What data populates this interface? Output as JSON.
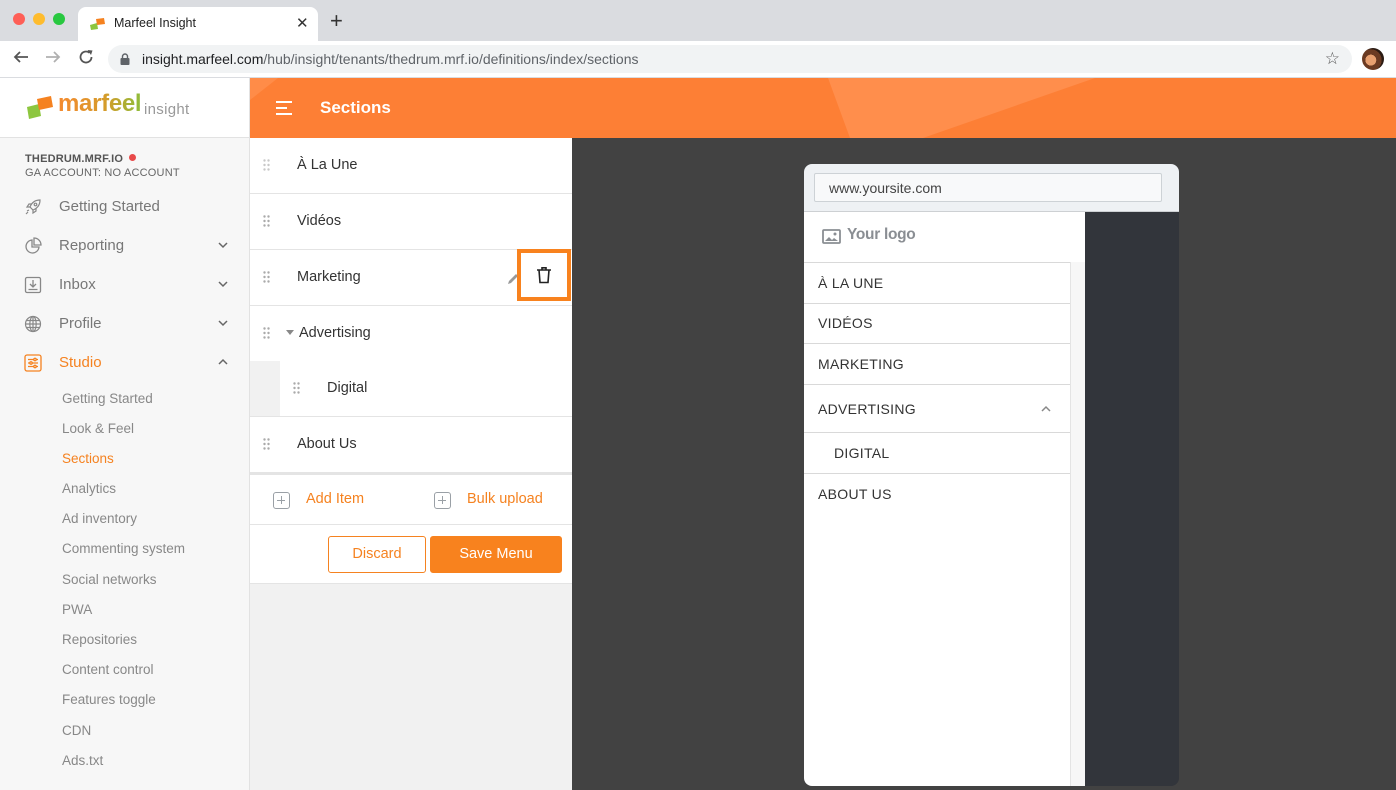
{
  "browser": {
    "tab_title": "Marfeel Insight",
    "url_host": "insight.marfeel.com",
    "url_path": "/hub/insight/tenants/thedrum.mrf.io/definitions/index/sections",
    "icons": {
      "back": "arrow-left-icon",
      "forward": "arrow-right-icon",
      "reload": "reload-icon",
      "lock": "lock-icon",
      "bookmark": "star-icon",
      "close_tab": "close-icon",
      "new_tab": "plus-icon"
    }
  },
  "sidebar": {
    "logo_word": "marfeel",
    "logo_sub": "insight",
    "tenant": "THEDRUM.MRF.IO",
    "tenant_status_color": "#e84a4a",
    "ga_account": "GA ACCOUNT: NO ACCOUNT",
    "nav": [
      {
        "label": "Getting Started",
        "icon": "rocket-icon",
        "expandable": false
      },
      {
        "label": "Reporting",
        "icon": "pie-chart-icon",
        "expandable": true,
        "expanded": false
      },
      {
        "label": "Inbox",
        "icon": "inbox-download-icon",
        "expandable": true,
        "expanded": false
      },
      {
        "label": "Profile",
        "icon": "globe-icon",
        "expandable": true,
        "expanded": false
      },
      {
        "label": "Studio",
        "icon": "sliders-icon",
        "expandable": true,
        "expanded": true,
        "active": true
      }
    ],
    "studio_items": [
      {
        "label": "Getting Started"
      },
      {
        "label": "Look & Feel"
      },
      {
        "label": "Sections",
        "active": true
      },
      {
        "label": "Analytics"
      },
      {
        "label": "Ad inventory"
      },
      {
        "label": "Commenting system"
      },
      {
        "label": "Social networks"
      },
      {
        "label": "PWA"
      },
      {
        "label": "Repositories"
      },
      {
        "label": "Content control"
      },
      {
        "label": "Features toggle"
      },
      {
        "label": "CDN"
      },
      {
        "label": "Ads.txt"
      }
    ]
  },
  "header": {
    "title": "Sections",
    "menu_icon": "hamburger-icon"
  },
  "editor": {
    "sections": [
      {
        "label": "À La Une",
        "level": 0
      },
      {
        "label": "Vidéos",
        "level": 0
      },
      {
        "label": "Marketing",
        "level": 0,
        "hovered": true,
        "actions": [
          "edit",
          "delete"
        ]
      },
      {
        "label": "Advertising",
        "level": 0,
        "expanded": true
      },
      {
        "label": "Digital",
        "level": 1
      },
      {
        "label": "About Us",
        "level": 0
      }
    ],
    "add_item_label": "Add Item",
    "bulk_upload_label": "Bulk upload",
    "discard_label": "Discard",
    "save_label": "Save Menu"
  },
  "preview": {
    "url": "www.yoursite.com",
    "logo_text": "Your logo",
    "menu": [
      {
        "label": "À LA UNE"
      },
      {
        "label": "VIDÉOS"
      },
      {
        "label": "MARKETING"
      },
      {
        "label": "ADVERTISING",
        "expanded": true
      },
      {
        "label": "DIGITAL",
        "child": true
      },
      {
        "label": "ABOUT US"
      }
    ]
  },
  "colors": {
    "accent": "#f58220",
    "header": "#fd7f35",
    "preview_bg": "#424242",
    "device_bg": "#32353b"
  }
}
